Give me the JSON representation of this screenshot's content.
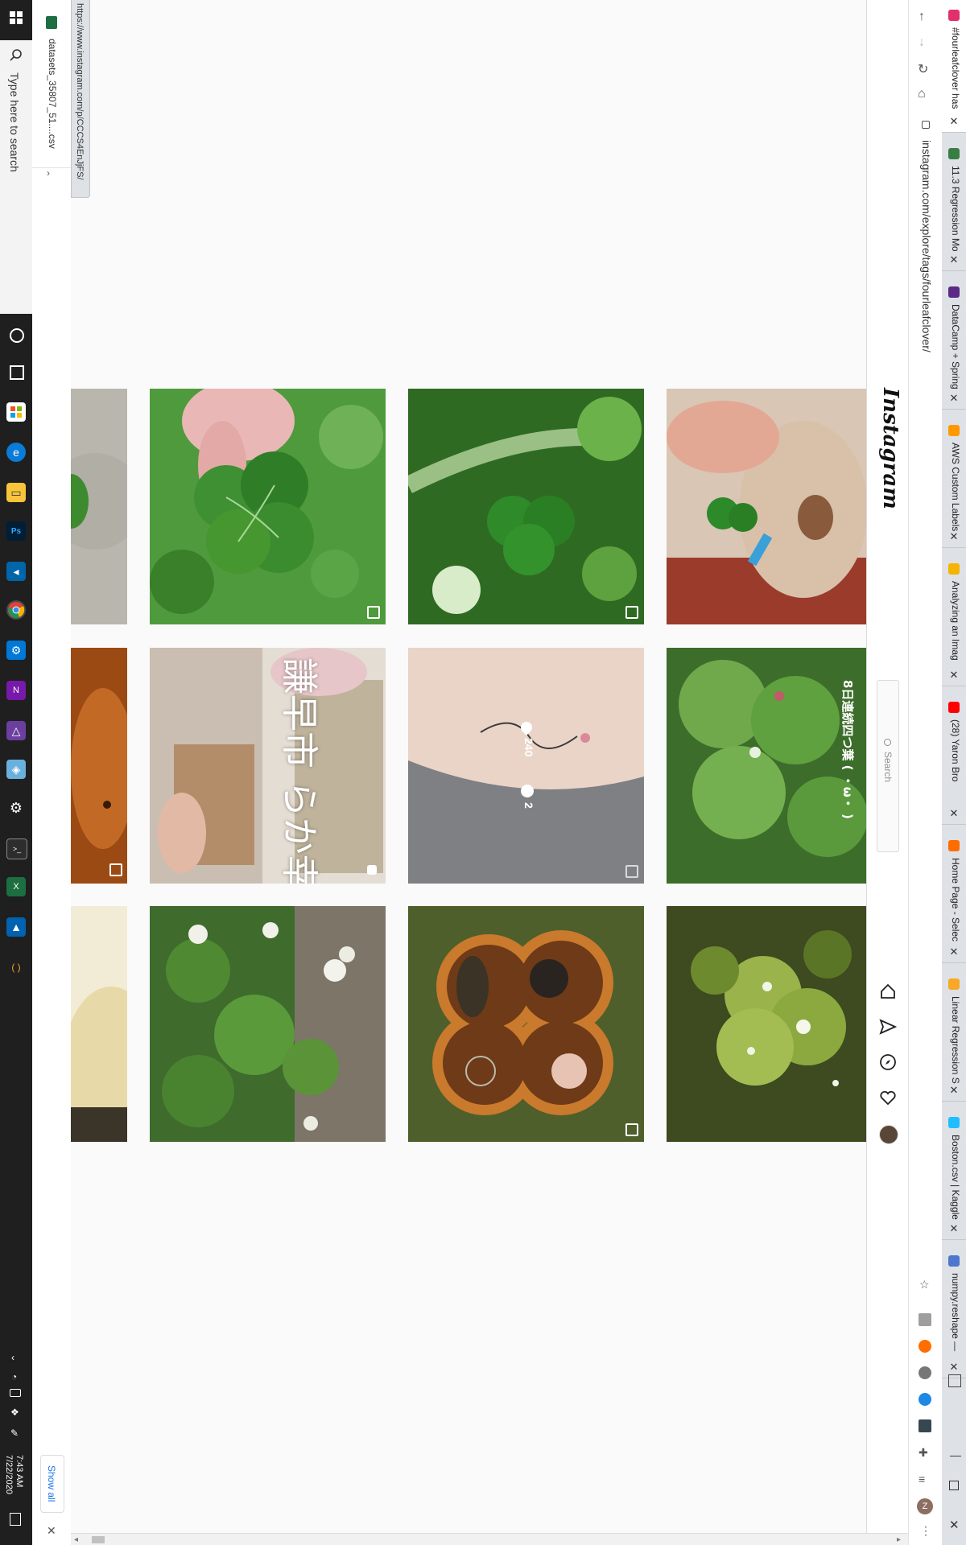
{
  "taskbar": {
    "search_placeholder": "Type here to search",
    "time": "7:43 AM",
    "date": "7/22/2020"
  },
  "download_bar": {
    "file_name": "datasets_35807_51....csv",
    "show_all_label": "Show all"
  },
  "status_url": "https://www.instagram.com/p/CCCS4EnJjFS/",
  "address_bar": {
    "url": "instagram.com/explore/tags/fourleafclover/"
  },
  "tabs": [
    {
      "title": "#fourleafclover has",
      "color": "#e1306c"
    },
    {
      "title": "11.3 Regression Mo",
      "color": "#3a7d44"
    },
    {
      "title": "DataCamp + Spring",
      "color": "#5b2a86"
    },
    {
      "title": "AWS Custom Labels",
      "color": "#ff9900"
    },
    {
      "title": "Analyzing an Imag",
      "color": "#f4b400"
    },
    {
      "title": "(28) Yaron Bro",
      "color": "#ff0000"
    },
    {
      "title": "Home Page - Selec",
      "color": "#ff6d00"
    },
    {
      "title": "Linear Regression S",
      "color": "#f9a825"
    },
    {
      "title": "Boston.csv | Kaggle",
      "color": "#20beff"
    },
    {
      "title": "numpy.reshape —",
      "color": "#4d77cf"
    }
  ],
  "instagram": {
    "logo": "Instagram",
    "search_placeholder": "Search",
    "hover_likes": "240",
    "hover_comments": "2",
    "overlay_text_jp": "謙早市 らか幸盛賞",
    "overlay_text_jp2": "8日連続四つ葉 ( ・ω・ )"
  },
  "colors": {
    "taskbar_bg": "#1f1f1f",
    "tabstrip_bg": "#dee1e6",
    "page_bg": "#fafafa"
  }
}
